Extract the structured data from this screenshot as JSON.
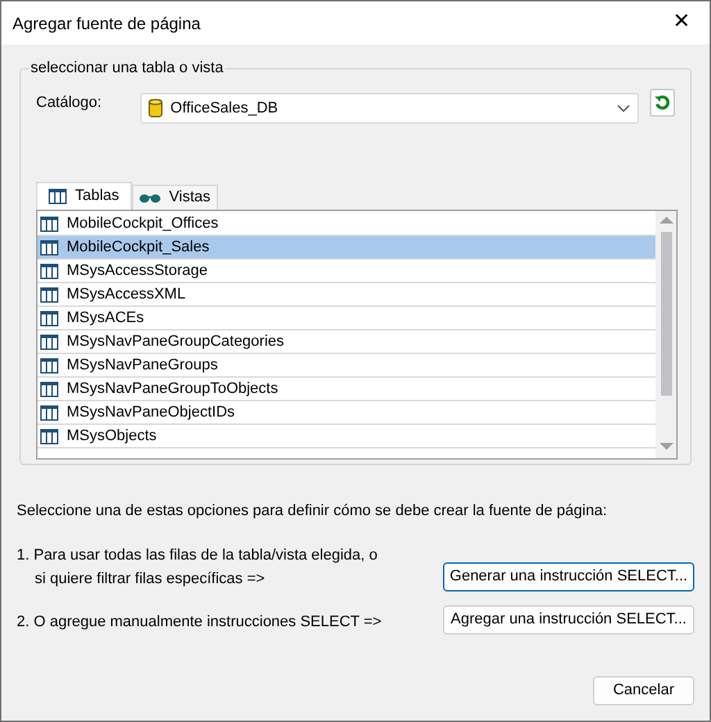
{
  "window": {
    "title": "Agregar fuente de página",
    "close": "✕"
  },
  "group": {
    "title": "seleccionar una tabla o vista",
    "catalog_label": "Catálogo:",
    "catalog_value": "OfficeSales_DB"
  },
  "tabs": [
    {
      "label": "Tablas",
      "kind": "tables",
      "selected": true
    },
    {
      "label": "Vistas",
      "kind": "views",
      "selected": false
    }
  ],
  "list": [
    {
      "label": "MobileCockpit_Offices",
      "selected": false
    },
    {
      "label": "MobileCockpit_Sales",
      "selected": true
    },
    {
      "label": "MSysAccessStorage",
      "selected": false
    },
    {
      "label": "MSysAccessXML",
      "selected": false
    },
    {
      "label": "MSysACEs",
      "selected": false
    },
    {
      "label": "MSysNavPaneGroupCategories",
      "selected": false
    },
    {
      "label": "MSysNavPaneGroups",
      "selected": false
    },
    {
      "label": "MSysNavPaneGroupToObjects",
      "selected": false
    },
    {
      "label": "MSysNavPaneObjectIDs",
      "selected": false
    },
    {
      "label": "MSysObjects",
      "selected": false
    }
  ],
  "instructions": "Seleccione una de estas opciones para definir cómo se debe crear la fuente de página:",
  "options": [
    {
      "lines": [
        "1. Para usar todas las filas de la tabla/vista elegida, o",
        "si quiere filtrar filas específicas =>"
      ],
      "button": "Generar una instrucción SELECT...",
      "focused": true
    },
    {
      "lines": [
        "2. O agregue manualmente instrucciones SELECT =>"
      ],
      "button": "Agregar una instrucción SELECT...",
      "focused": false
    }
  ],
  "cancel": "Cancelar"
}
